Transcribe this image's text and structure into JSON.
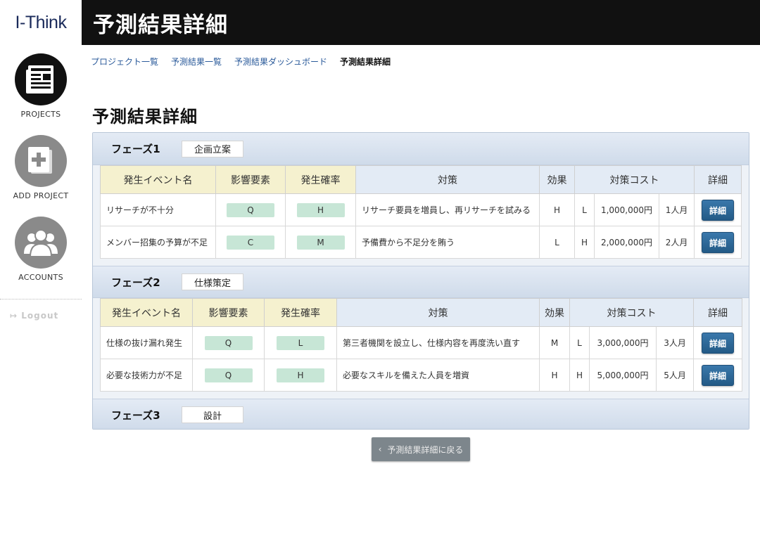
{
  "app": {
    "logo": "I-Think",
    "title": "予測結果詳細"
  },
  "sidebar": {
    "items": [
      {
        "label": "PROJECTS",
        "icon": "newspaper-icon"
      },
      {
        "label": "ADD PROJECT",
        "icon": "add-document-icon"
      },
      {
        "label": "ACCOUNTS",
        "icon": "users-icon"
      }
    ],
    "logout": "Logout"
  },
  "breadcrumb": {
    "items": [
      "プロジェクト一覧",
      "予測結果一覧",
      "予測結果ダッシュボード"
    ],
    "current": "予測結果詳細"
  },
  "page": {
    "title": "予測結果詳細"
  },
  "table_headers": {
    "event": "発生イベント名",
    "factor": "影響要素",
    "prob": "発生確率",
    "measure": "対策",
    "effect": "効果",
    "cost": "対策コスト",
    "detail": "詳細"
  },
  "phases": [
    {
      "label": "フェーズ1",
      "name": "企画立案",
      "rows": [
        {
          "event": "リサーチが不十分",
          "factor": "Q",
          "prob": "H",
          "measure": "リサーチ要員を増員し、再リサーチを試みる",
          "effect": "H",
          "cost_level": "L",
          "cost_amount": "1,000,000円",
          "cost_people": "1人月",
          "detail": "詳細"
        },
        {
          "event": "メンバー招集の予算が不足",
          "factor": "C",
          "prob": "M",
          "measure": "予備費から不足分を賄う",
          "effect": "L",
          "cost_level": "H",
          "cost_amount": "2,000,000円",
          "cost_people": "2人月",
          "detail": "詳細"
        }
      ]
    },
    {
      "label": "フェーズ2",
      "name": "仕様策定",
      "rows": [
        {
          "event": "仕様の抜け漏れ発生",
          "factor": "Q",
          "prob": "L",
          "measure": "第三者機関を設立し、仕様内容を再度洗い直す",
          "effect": "M",
          "cost_level": "L",
          "cost_amount": "3,000,000円",
          "cost_people": "3人月",
          "detail": "詳細"
        },
        {
          "event": "必要な技術力が不足",
          "factor": "Q",
          "prob": "H",
          "measure": "必要なスキルを備えた人員を増資",
          "effect": "H",
          "cost_level": "H",
          "cost_amount": "5,000,000円",
          "cost_people": "5人月",
          "detail": "詳細"
        }
      ]
    },
    {
      "label": "フェーズ3",
      "name": "設計",
      "rows": []
    }
  ],
  "back_button": {
    "label": "予測結果詳細に戻る",
    "icon": "chevron-left-icon"
  }
}
